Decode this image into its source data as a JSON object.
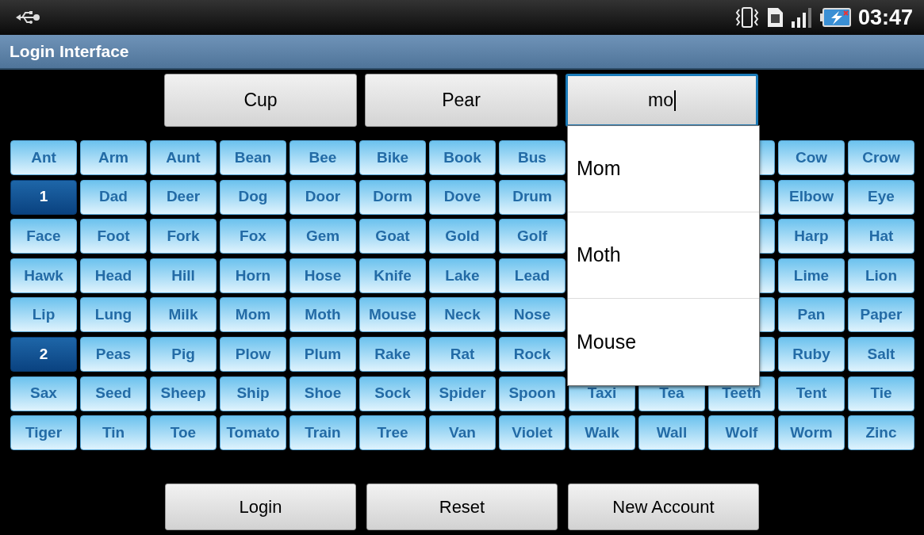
{
  "status_bar": {
    "time": "03:47"
  },
  "window": {
    "title": "Login Interface"
  },
  "fields": [
    {
      "value": "Cup",
      "focused": false
    },
    {
      "value": "Pear",
      "focused": false
    },
    {
      "value": "mo",
      "focused": true
    }
  ],
  "grid": [
    [
      {
        "label": "Ant",
        "kind": "word"
      },
      {
        "label": "Arm",
        "kind": "word"
      },
      {
        "label": "Aunt",
        "kind": "word"
      },
      {
        "label": "Bean",
        "kind": "word"
      },
      {
        "label": "Bee",
        "kind": "word"
      },
      {
        "label": "Bike",
        "kind": "word"
      },
      {
        "label": "Book",
        "kind": "word"
      },
      {
        "label": "Bus",
        "kind": "word"
      },
      {
        "kind": "covered"
      },
      {
        "kind": "covered"
      },
      {
        "kind": "covered"
      },
      {
        "label": "Cow",
        "kind": "word"
      },
      {
        "label": "Crow",
        "kind": "word"
      }
    ],
    [
      {
        "label": "1",
        "kind": "number"
      },
      {
        "label": "Dad",
        "kind": "word"
      },
      {
        "label": "Deer",
        "kind": "word"
      },
      {
        "label": "Dog",
        "kind": "word"
      },
      {
        "label": "Door",
        "kind": "word"
      },
      {
        "label": "Dorm",
        "kind": "word"
      },
      {
        "label": "Dove",
        "kind": "word"
      },
      {
        "label": "Drum",
        "kind": "word"
      },
      {
        "kind": "covered"
      },
      {
        "kind": "covered"
      },
      {
        "kind": "covered"
      },
      {
        "label": "Elbow",
        "kind": "word"
      },
      {
        "label": "Eye",
        "kind": "word"
      }
    ],
    [
      {
        "label": "Face",
        "kind": "word"
      },
      {
        "label": "Foot",
        "kind": "word"
      },
      {
        "label": "Fork",
        "kind": "word"
      },
      {
        "label": "Fox",
        "kind": "word"
      },
      {
        "label": "Gem",
        "kind": "word"
      },
      {
        "label": "Goat",
        "kind": "word"
      },
      {
        "label": "Gold",
        "kind": "word"
      },
      {
        "label": "Golf",
        "kind": "word"
      },
      {
        "kind": "covered"
      },
      {
        "kind": "covered"
      },
      {
        "kind": "covered"
      },
      {
        "label": "Harp",
        "kind": "word"
      },
      {
        "label": "Hat",
        "kind": "word"
      }
    ],
    [
      {
        "label": "Hawk",
        "kind": "word"
      },
      {
        "label": "Head",
        "kind": "word"
      },
      {
        "label": "Hill",
        "kind": "word"
      },
      {
        "label": "Horn",
        "kind": "word"
      },
      {
        "label": "Hose",
        "kind": "word"
      },
      {
        "label": "Knife",
        "kind": "word"
      },
      {
        "label": "Lake",
        "kind": "word"
      },
      {
        "label": "Lead",
        "kind": "word"
      },
      {
        "kind": "covered"
      },
      {
        "kind": "covered"
      },
      {
        "kind": "covered"
      },
      {
        "label": "Lime",
        "kind": "word"
      },
      {
        "label": "Lion",
        "kind": "word"
      }
    ],
    [
      {
        "label": "Lip",
        "kind": "word"
      },
      {
        "label": "Lung",
        "kind": "word"
      },
      {
        "label": "Milk",
        "kind": "word"
      },
      {
        "label": "Mom",
        "kind": "word"
      },
      {
        "label": "Moth",
        "kind": "word"
      },
      {
        "label": "Mouse",
        "kind": "word"
      },
      {
        "label": "Neck",
        "kind": "word"
      },
      {
        "label": "Nose",
        "kind": "word"
      },
      {
        "kind": "covered"
      },
      {
        "kind": "covered"
      },
      {
        "kind": "covered"
      },
      {
        "label": "Pan",
        "kind": "word"
      },
      {
        "label": "Paper",
        "kind": "word"
      }
    ],
    [
      {
        "label": "2",
        "kind": "number"
      },
      {
        "label": "Peas",
        "kind": "word"
      },
      {
        "label": "Pig",
        "kind": "word"
      },
      {
        "label": "Plow",
        "kind": "word"
      },
      {
        "label": "Plum",
        "kind": "word"
      },
      {
        "label": "Rake",
        "kind": "word"
      },
      {
        "label": "Rat",
        "kind": "word"
      },
      {
        "label": "Rock",
        "kind": "word"
      },
      {
        "kind": "covered"
      },
      {
        "kind": "covered"
      },
      {
        "kind": "covered"
      },
      {
        "label": "Ruby",
        "kind": "word"
      },
      {
        "label": "Salt",
        "kind": "word"
      }
    ],
    [
      {
        "label": "Sax",
        "kind": "word"
      },
      {
        "label": "Seed",
        "kind": "word"
      },
      {
        "label": "Sheep",
        "kind": "word"
      },
      {
        "label": "Ship",
        "kind": "word"
      },
      {
        "label": "Shoe",
        "kind": "word"
      },
      {
        "label": "Sock",
        "kind": "word"
      },
      {
        "label": "Spider",
        "kind": "word"
      },
      {
        "label": "Spoon",
        "kind": "word"
      },
      {
        "label": "Taxi",
        "kind": "word"
      },
      {
        "label": "Tea",
        "kind": "word"
      },
      {
        "label": "Teeth",
        "kind": "word"
      },
      {
        "label": "Tent",
        "kind": "word"
      },
      {
        "label": "Tie",
        "kind": "word"
      }
    ],
    [
      {
        "label": "Tiger",
        "kind": "word"
      },
      {
        "label": "Tin",
        "kind": "word"
      },
      {
        "label": "Toe",
        "kind": "word"
      },
      {
        "label": "Tomato",
        "kind": "word"
      },
      {
        "label": "Train",
        "kind": "word"
      },
      {
        "label": "Tree",
        "kind": "word"
      },
      {
        "label": "Van",
        "kind": "word"
      },
      {
        "label": "Violet",
        "kind": "word"
      },
      {
        "label": "Walk",
        "kind": "word"
      },
      {
        "label": "Wall",
        "kind": "word"
      },
      {
        "label": "Wolf",
        "kind": "word"
      },
      {
        "label": "Worm",
        "kind": "word"
      },
      {
        "label": "Zinc",
        "kind": "word"
      }
    ]
  ],
  "suggestions": [
    "Mom",
    "Moth",
    "Mouse"
  ],
  "buttons": [
    "Login",
    "Reset",
    "New Account"
  ]
}
